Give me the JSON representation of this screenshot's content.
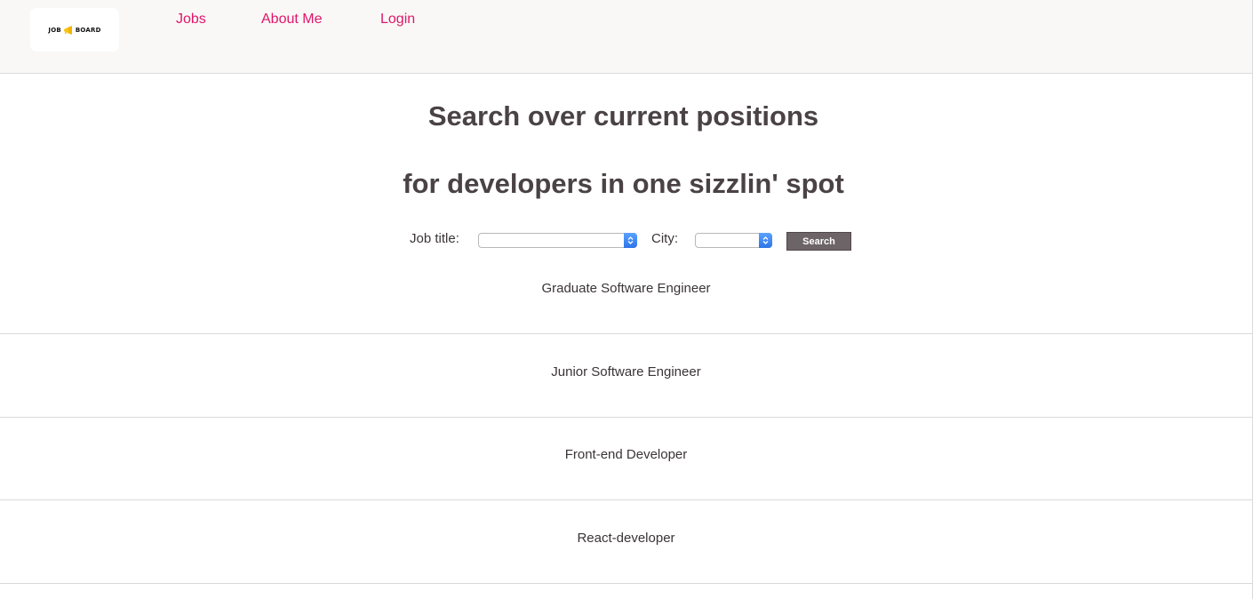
{
  "header": {
    "logo": {
      "left": "JOB",
      "right": "BOARD",
      "icon": "megaphone-icon",
      "accent": "#f5c518"
    },
    "nav": [
      {
        "label": "Jobs"
      },
      {
        "label": "About Me"
      },
      {
        "label": "Login"
      }
    ],
    "link_color": "#e0166a"
  },
  "main": {
    "headline_1": "Search over current positions",
    "headline_2": "for developers in one sizzlin' spot",
    "search": {
      "job_title_label": "Job title:",
      "job_title_value": "",
      "city_label": "City:",
      "city_value": "",
      "button_label": "Search"
    },
    "jobs": [
      {
        "title": "Graduate Software Engineer"
      },
      {
        "title": "Junior Software Engineer"
      },
      {
        "title": "Front-end Developer"
      },
      {
        "title": "React-developer"
      }
    ]
  }
}
